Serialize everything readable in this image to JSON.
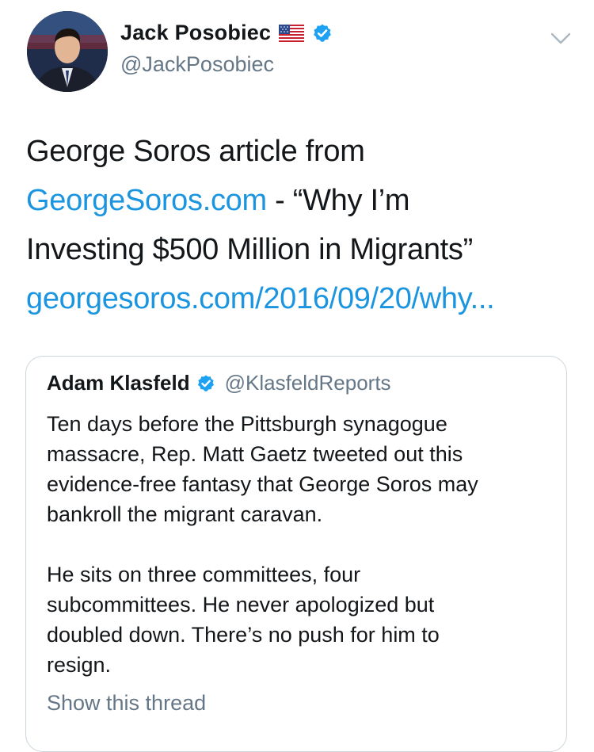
{
  "author": {
    "display_name": "Jack Posobiec",
    "handle": "@JackPosobiec",
    "flag_icon": "us-flag-icon",
    "verified_icon": "verified-badge-icon"
  },
  "tweet": {
    "lines": [
      [
        "George Soros article from"
      ],
      [
        "GeorgeSoros.com",
        " - “Why I’m"
      ],
      [
        "Investing $500 Million in Migrants”"
      ],
      [
        "georgesoros.com/2016/09/20/why..."
      ]
    ],
    "text_plain_1": "George Soros article from",
    "link_1": "GeorgeSoros.com",
    "text_plain_2": " - “Why I’m",
    "text_plain_3": "Investing $500 Million in Migrants”",
    "link_2": "georgesoros.com/2016/09/20/why..."
  },
  "quoted_tweet": {
    "display_name": "Adam Klasfeld",
    "handle": "@KlasfeldReports",
    "paragraph_1": [
      "Ten days before the Pittsburgh synagogue",
      "massacre, Rep. Matt Gaetz tweeted out this",
      "evidence-free fantasy that George Soros may",
      "bankroll the migrant caravan."
    ],
    "paragraph_2": [
      "He sits on three committees, four",
      "subcommittees. He never apologized but",
      "doubled down. There’s no push for him to",
      "resign."
    ],
    "show_thread": "Show this thread"
  },
  "colors": {
    "link": "#1b95e0",
    "secondary_text": "#657786",
    "primary_text": "#14171a",
    "border": "#ccd6dd",
    "verified": "#1da1f2"
  }
}
